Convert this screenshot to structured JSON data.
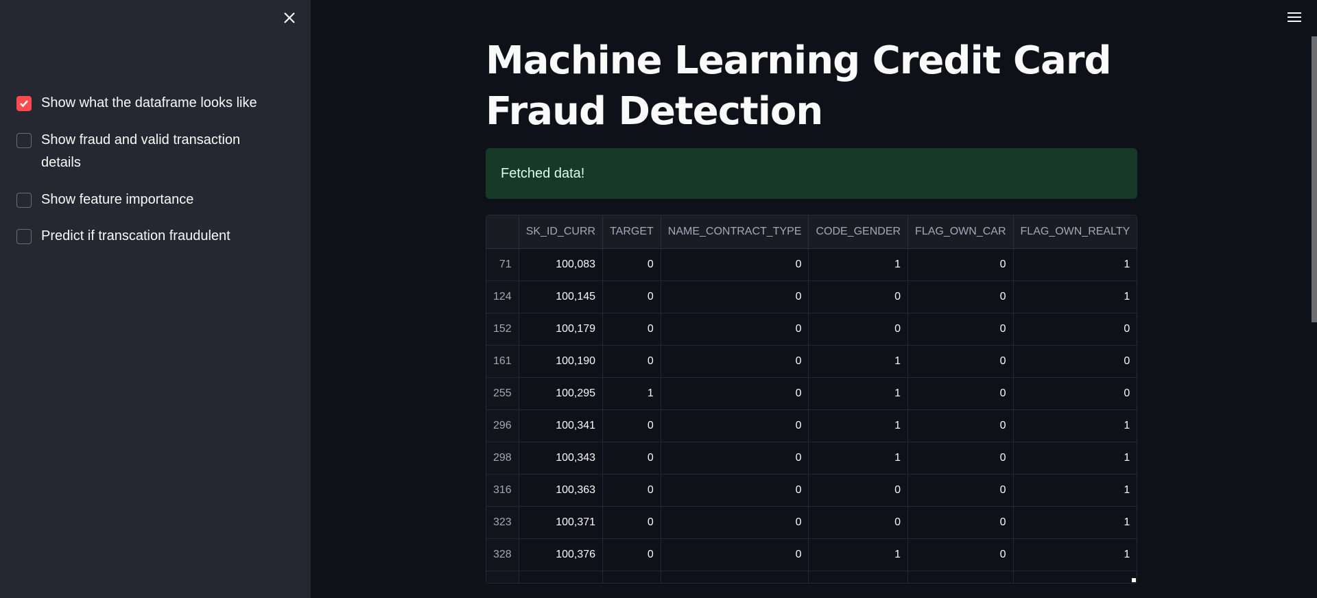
{
  "sidebar": {
    "checkboxes": [
      {
        "label": "Show what the dataframe looks like",
        "checked": true
      },
      {
        "label": "Show fraud and valid transaction details",
        "checked": false
      },
      {
        "label": "Show feature importance",
        "checked": false
      },
      {
        "label": "Predict if transcation fraudulent",
        "checked": false
      }
    ]
  },
  "main": {
    "title": "Machine Learning Credit Card Fraud Detection",
    "alert": "Fetched data!",
    "table": {
      "columns": [
        "",
        "SK_ID_CURR",
        "TARGET",
        "NAME_CONTRACT_TYPE",
        "CODE_GENDER",
        "FLAG_OWN_CAR",
        "FLAG_OWN_REALTY"
      ],
      "rows": [
        [
          "71",
          "100,083",
          "0",
          "0",
          "1",
          "0",
          "1"
        ],
        [
          "124",
          "100,145",
          "0",
          "0",
          "0",
          "0",
          "1"
        ],
        [
          "152",
          "100,179",
          "0",
          "0",
          "0",
          "0",
          "0"
        ],
        [
          "161",
          "100,190",
          "0",
          "0",
          "1",
          "0",
          "0"
        ],
        [
          "255",
          "100,295",
          "1",
          "0",
          "1",
          "0",
          "0"
        ],
        [
          "296",
          "100,341",
          "0",
          "0",
          "1",
          "0",
          "1"
        ],
        [
          "298",
          "100,343",
          "0",
          "0",
          "1",
          "0",
          "1"
        ],
        [
          "316",
          "100,363",
          "0",
          "0",
          "0",
          "0",
          "1"
        ],
        [
          "323",
          "100,371",
          "0",
          "0",
          "0",
          "0",
          "1"
        ],
        [
          "328",
          "100,376",
          "0",
          "0",
          "1",
          "0",
          "1"
        ],
        [
          "",
          "",
          "",
          "",
          "",
          "",
          ""
        ]
      ]
    }
  },
  "colors": {
    "accent": "#ff4b4b",
    "success_bg": "#173928"
  }
}
